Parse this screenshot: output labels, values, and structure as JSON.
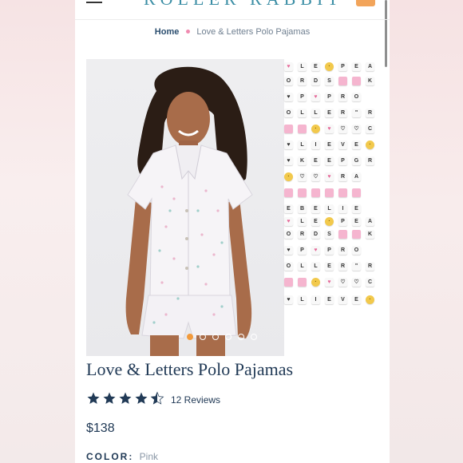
{
  "breadcrumb": {
    "home": "Home",
    "current": "Love & Letters Polo Pajamas"
  },
  "header": {
    "logo_text": "ROLLER RABBIT"
  },
  "gallery": {
    "slide_count": 6,
    "active_slide": 1
  },
  "product": {
    "title": "Love & Letters Polo Pajamas",
    "rating": 4.5,
    "reviews_label": "12 Reviews",
    "price": "$138",
    "color_label": "COLOR:",
    "color_value": "Pink"
  },
  "colors": {
    "brand": "#3b8ea5",
    "accent": "#f29a3c",
    "text": "#213a56"
  },
  "icons": [
    "hamburger-icon",
    "cart-icon",
    "star-icon"
  ]
}
